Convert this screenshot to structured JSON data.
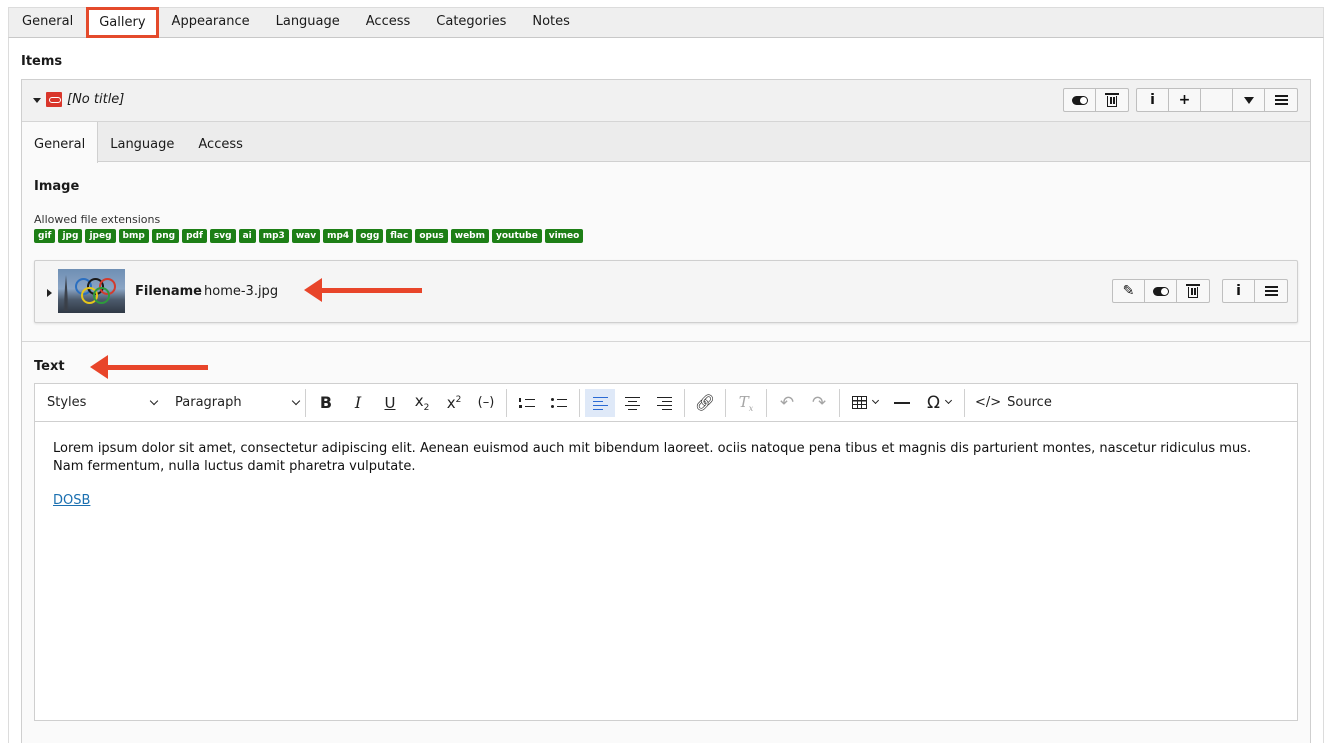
{
  "top_tabs": [
    {
      "label": "General"
    },
    {
      "label": "Gallery"
    },
    {
      "label": "Appearance"
    },
    {
      "label": "Language"
    },
    {
      "label": "Access"
    },
    {
      "label": "Categories"
    },
    {
      "label": "Notes"
    }
  ],
  "items_label": "Items",
  "item": {
    "title": "[No title]",
    "inner_tabs": [
      {
        "label": "General"
      },
      {
        "label": "Language"
      },
      {
        "label": "Access"
      }
    ],
    "image_label": "Image",
    "allowed_label": "Allowed file extensions",
    "extensions": [
      "gif",
      "jpg",
      "jpeg",
      "bmp",
      "png",
      "pdf",
      "svg",
      "ai",
      "mp3",
      "wav",
      "mp4",
      "ogg",
      "flac",
      "opus",
      "webm",
      "youtube",
      "vimeo"
    ],
    "file": {
      "label": "Filename",
      "name": "home-3.jpg"
    },
    "text_label": "Text"
  },
  "editor": {
    "styles_label": "Styles",
    "paragraph_label": "Paragraph",
    "source_label": "Source",
    "body": "Lorem ipsum dolor sit amet, consectetur adipiscing elit. Aenean euismod auch mit bibendum laoreet. ociis natoque pena tibus et magnis dis parturient montes, nascetur ridiculus mus. Nam fermentum, nulla luctus damit pharetra vulputate.",
    "link": "DOSB"
  },
  "colors": {
    "highlight": "#e44a2b",
    "extension_badge": "#1d7f16",
    "link": "#1a6fb0"
  }
}
